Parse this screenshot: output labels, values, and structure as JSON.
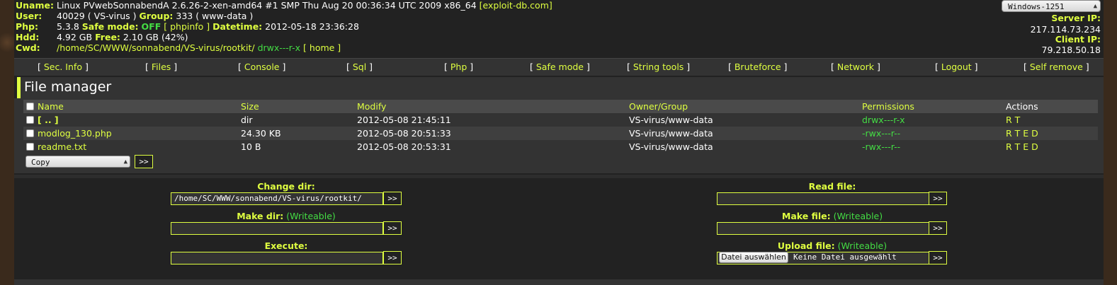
{
  "header": {
    "uname_label": "Uname:",
    "uname_value": "Linux PVwebSonnabendA 2.6.26-2-xen-amd64 #1 SMP Thu Aug 20 00:36:34 UTC 2009 x86_64",
    "uname_link": "[exploit-db.com]",
    "user_label": "User:",
    "user_value": "40029 ( VS-virus )",
    "group_label": "Group:",
    "group_value": "333 ( www-data )",
    "php_label": "Php:",
    "php_value": "5.3.8",
    "safe_label": "Safe mode:",
    "safe_value": "OFF",
    "phpinfo_link": "[ phpinfo ]",
    "datetime_label": "Datetime:",
    "datetime_value": "2012-05-18 23:36:28",
    "hdd_label": "Hdd:",
    "hdd_value": "4.92 GB",
    "free_label": "Free:",
    "free_value": "2.10 GB (42%)",
    "cwd_label": "Cwd:",
    "cwd_value": "/home/SC/WWW/sonnabend/VS-virus/rootkit/",
    "cwd_perms": "drwx---r-x",
    "home_link": "[ home ]",
    "charset": "Windows-1251",
    "server_ip_label": "Server IP:",
    "server_ip": "217.114.73.234",
    "client_ip_label": "Client IP:",
    "client_ip": "79.218.50.18"
  },
  "menu": [
    "Sec. Info",
    "Files",
    "Console",
    "Sql",
    "Php",
    "Safe mode",
    "String tools",
    "Bruteforce",
    "Network",
    "Logout",
    "Self remove"
  ],
  "file_manager": {
    "title": "File manager",
    "columns": [
      "Name",
      "Size",
      "Modify",
      "Owner/Group",
      "Permissions",
      "Actions"
    ],
    "rows": [
      {
        "name": "[ .. ]",
        "size": "dir",
        "modify": "2012-05-08 21:45:11",
        "owner": "VS-virus/www-data",
        "perms": "drwx---r-x",
        "actions": "R T"
      },
      {
        "name": "modlog_130.php",
        "size": "24.30 KB",
        "modify": "2012-05-08 20:51:33",
        "owner": "VS-virus/www-data",
        "perms": "-rwx---r--",
        "actions": "R T E D"
      },
      {
        "name": "readme.txt",
        "size": "10 B",
        "modify": "2012-05-08 20:53:31",
        "owner": "VS-virus/www-data",
        "perms": "-rwx---r--",
        "actions": "R T E D"
      }
    ],
    "action_select": "Copy",
    "go_label": ">>"
  },
  "forms": {
    "change_dir_label": "Change dir:",
    "change_dir_value": "/home/SC/WWW/sonnabend/VS-virus/rootkit/",
    "make_dir_label": "Make dir:",
    "make_dir_note": "(Writeable)",
    "execute_label": "Execute:",
    "read_file_label": "Read file:",
    "make_file_label": "Make file:",
    "make_file_note": "(Writeable)",
    "upload_file_label": "Upload file:",
    "upload_file_note": "(Writeable)",
    "choose_file_button": "Datei auswählen",
    "no_file_text": "Keine Datei ausgewählt",
    "submit_label": ">>"
  },
  "colors": {
    "accent": "#dfff40",
    "ok": "#44dd44",
    "bg": "#222222",
    "panel": "#333333"
  }
}
